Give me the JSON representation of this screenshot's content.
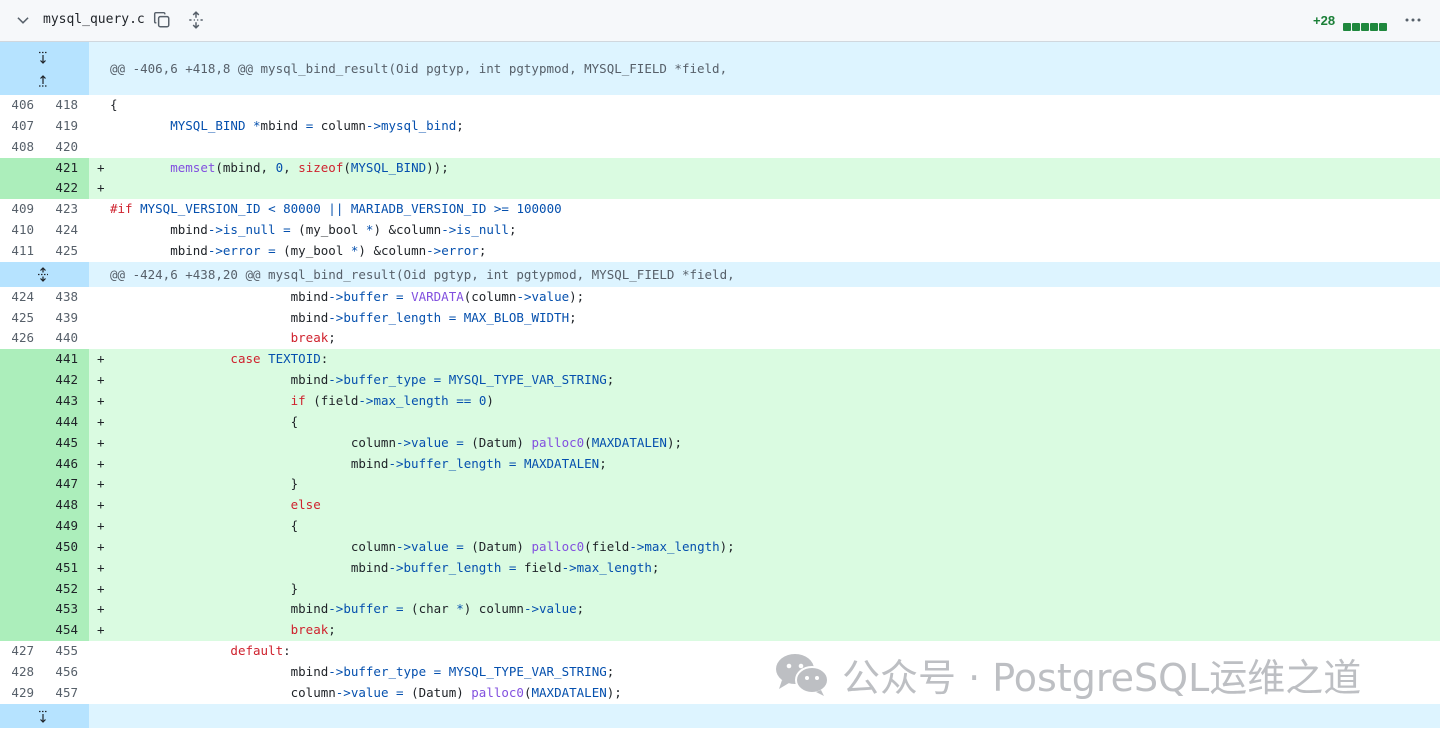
{
  "header": {
    "file_name": "mysql_query.c",
    "additions": "+28",
    "diffstat_blocks": 5
  },
  "colors": {
    "addition_bg": "#dafbe1",
    "addition_gutter": "#aceebb",
    "hunk_bg": "#ddf4ff",
    "hunk_gutter": "#b6e3ff",
    "keyword": "#cf222e",
    "function": "#8250df",
    "constant": "#0550ae"
  },
  "hunks": [
    "@@ -406,6 +418,8 @@ mysql_bind_result(Oid pgtyp, int pgtypmod, MYSQL_FIELD *field,",
    "@@ -424,6 +438,20 @@ mysql_bind_result(Oid pgtyp, int pgtypmod, MYSQL_FIELD *field,"
  ],
  "lines": [
    {
      "type": "ctx",
      "old": "406",
      "new": "418",
      "text": "{"
    },
    {
      "type": "ctx",
      "old": "407",
      "new": "419",
      "text": "\tMYSQL_BIND *mbind = column->mysql_bind;"
    },
    {
      "type": "ctx",
      "old": "408",
      "new": "420",
      "text": ""
    },
    {
      "type": "add",
      "old": "",
      "new": "421",
      "text": "\tmemset(mbind, 0, sizeof(MYSQL_BIND));"
    },
    {
      "type": "add",
      "old": "",
      "new": "422",
      "text": ""
    },
    {
      "type": "ctx",
      "old": "409",
      "new": "423",
      "text": "#if MYSQL_VERSION_ID < 80000 || MARIADB_VERSION_ID >= 100000"
    },
    {
      "type": "ctx",
      "old": "410",
      "new": "424",
      "text": "\tmbind->is_null = (my_bool *) &column->is_null;"
    },
    {
      "type": "ctx",
      "old": "411",
      "new": "425",
      "text": "\tmbind->error = (my_bool *) &column->error;"
    },
    {
      "type": "hunk",
      "index": 1
    },
    {
      "type": "ctx",
      "old": "424",
      "new": "438",
      "text": "\t\t\tmbind->buffer = VARDATA(column->value);"
    },
    {
      "type": "ctx",
      "old": "425",
      "new": "439",
      "text": "\t\t\tmbind->buffer_length = MAX_BLOB_WIDTH;"
    },
    {
      "type": "ctx",
      "old": "426",
      "new": "440",
      "text": "\t\t\tbreak;"
    },
    {
      "type": "add",
      "old": "",
      "new": "441",
      "text": "\t\tcase TEXTOID:"
    },
    {
      "type": "add",
      "old": "",
      "new": "442",
      "text": "\t\t\tmbind->buffer_type = MYSQL_TYPE_VAR_STRING;"
    },
    {
      "type": "add",
      "old": "",
      "new": "443",
      "text": "\t\t\tif (field->max_length == 0)"
    },
    {
      "type": "add",
      "old": "",
      "new": "444",
      "text": "\t\t\t{"
    },
    {
      "type": "add",
      "old": "",
      "new": "445",
      "text": "\t\t\t\tcolumn->value = (Datum) palloc0(MAXDATALEN);"
    },
    {
      "type": "add",
      "old": "",
      "new": "446",
      "text": "\t\t\t\tmbind->buffer_length = MAXDATALEN;"
    },
    {
      "type": "add",
      "old": "",
      "new": "447",
      "text": "\t\t\t}"
    },
    {
      "type": "add",
      "old": "",
      "new": "448",
      "text": "\t\t\telse"
    },
    {
      "type": "add",
      "old": "",
      "new": "449",
      "text": "\t\t\t{"
    },
    {
      "type": "add",
      "old": "",
      "new": "450",
      "text": "\t\t\t\tcolumn->value = (Datum) palloc0(field->max_length);"
    },
    {
      "type": "add",
      "old": "",
      "new": "451",
      "text": "\t\t\t\tmbind->buffer_length = field->max_length;"
    },
    {
      "type": "add",
      "old": "",
      "new": "452",
      "text": "\t\t\t}"
    },
    {
      "type": "add",
      "old": "",
      "new": "453",
      "text": "\t\t\tmbind->buffer = (char *) column->value;"
    },
    {
      "type": "add",
      "old": "",
      "new": "454",
      "text": "\t\t\tbreak;"
    },
    {
      "type": "ctx",
      "old": "427",
      "new": "455",
      "text": "\t\tdefault:"
    },
    {
      "type": "ctx",
      "old": "428",
      "new": "456",
      "text": "\t\t\tmbind->buffer_type = MYSQL_TYPE_VAR_STRING;"
    },
    {
      "type": "ctx",
      "old": "429",
      "new": "457",
      "text": "\t\t\tcolumn->value = (Datum) palloc0(MAXDATALEN);"
    }
  ],
  "tokens": {
    "keywords": [
      "#if",
      "sizeof",
      "case",
      "if",
      "else",
      "break",
      "default"
    ],
    "functions": [
      "memset",
      "palloc0",
      "VARDATA"
    ],
    "constants": [
      "MYSQL_VERSION_ID",
      "MARIADB_VERSION_ID",
      "MYSQL_BIND",
      "TEXTOID",
      "MYSQL_TYPE_VAR_STRING",
      "MAXDATALEN",
      "MAX_BLOB_WIDTH",
      "80000",
      "100000",
      "0",
      "is_null",
      "error",
      "buffer",
      "buffer_length",
      "buffer_type",
      "max_length",
      "value",
      "mysql_bind",
      "->",
      "=",
      "*",
      "==",
      ">=",
      "<",
      "||"
    ]
  },
  "watermark": {
    "text": "公众号 · PostgreSQL运维之道",
    "icon": "wechat-icon"
  }
}
